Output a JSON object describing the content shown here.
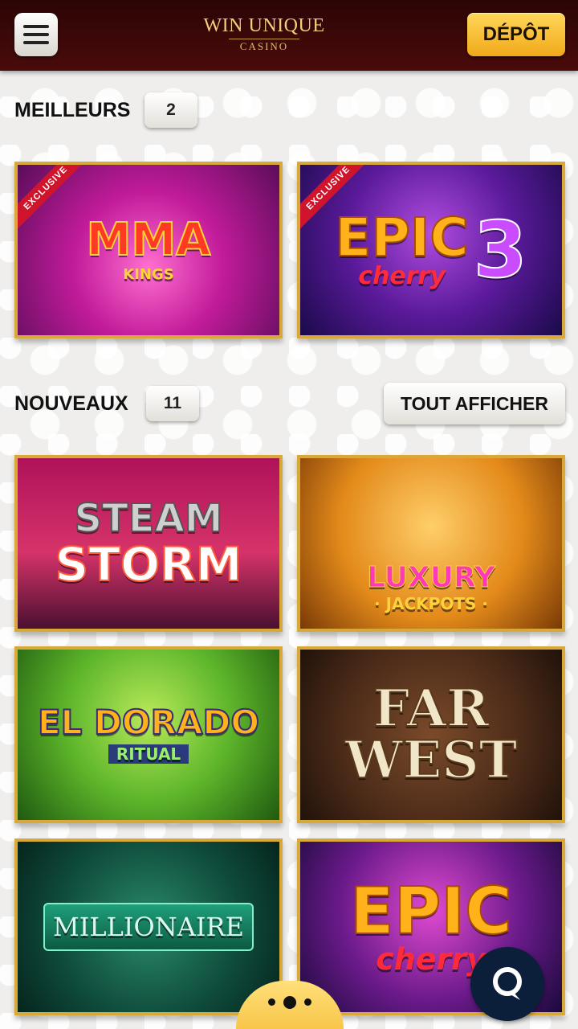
{
  "header": {
    "logo_main": "WIN UNIQUE",
    "logo_sub": "CASINO",
    "deposit_label": "DÉPÔT",
    "menu_icon": "hamburger-icon"
  },
  "sections": {
    "best": {
      "title": "MEILLEURS",
      "count": "2"
    },
    "new": {
      "title": "NOUVEAUX",
      "count": "11",
      "view_all": "TOUT AFFICHER"
    }
  },
  "games": {
    "best": [
      {
        "name": "MMA",
        "sub": "KINGS",
        "ribbon": "EXCLUSIVE"
      },
      {
        "name": "EPIC",
        "sub": "cherry",
        "extra": "3",
        "ribbon": "EXCLUSIVE"
      }
    ],
    "new": [
      {
        "name": "STEAM",
        "sub": "STORM"
      },
      {
        "name": "LUXURY",
        "sub": "· JACKPOTS ·"
      },
      {
        "name": "EL DORADO",
        "sub": "RITUAL"
      },
      {
        "name": "FAR",
        "sub": "WEST"
      },
      {
        "name": "MILLIONAIRE"
      },
      {
        "name": "EPIC",
        "sub": "cherry"
      }
    ]
  },
  "colors": {
    "header_bg": "#3a0808",
    "accent_gold": "#d8a938",
    "deposit_bg": "#f6c23a",
    "chat_bg": "#0b1e3a"
  }
}
